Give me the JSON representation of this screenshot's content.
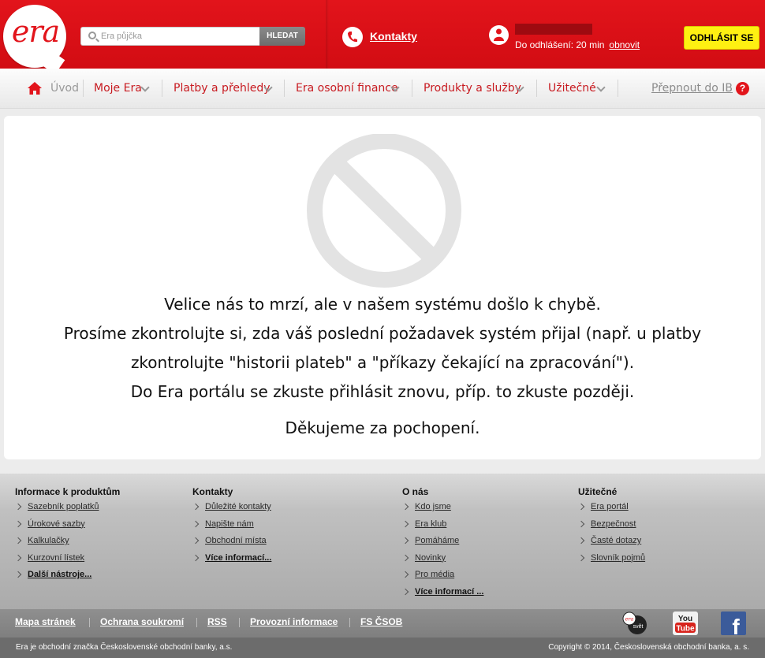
{
  "header": {
    "logo_text": "era",
    "search": {
      "placeholder": "Era půjčka",
      "button": "HLEDAT"
    },
    "contacts_label": "Kontakty",
    "user": {
      "logout_info": "Do odhlášení: 20 min",
      "renew_label": "obnovit"
    },
    "logout_button": "ODHLÁSIT SE"
  },
  "nav": {
    "home": "Úvod",
    "items": [
      "Moje Era",
      "Platby a přehledy",
      "Era osobní finance",
      "Produkty a služby",
      "Užitečné"
    ],
    "switch_label": "Přepnout do IB",
    "help": "?"
  },
  "content": {
    "lines": [
      "Velice nás to mrzí, ale v našem systému došlo k chybě.",
      "Prosíme zkontrolujte si, zda váš poslední požadavek systém přijal (např. u platby",
      "zkontrolujte \"historii plateb\" a \"příkazy čekající na zpracování\").",
      "Do Era portálu se zkuste přihlásit znovu, příp. to zkuste později."
    ],
    "thanks": "Děkujeme za pochopení."
  },
  "footer": {
    "columns": [
      {
        "title": "Informace k produktům",
        "links": [
          "Sazebník poplatků",
          "Úrokové sazby",
          "Kalkulačky",
          "Kurzovní lístek"
        ],
        "more": "Další nástroje..."
      },
      {
        "title": "Kontakty",
        "links": [
          "Důležité kontakty",
          "Napište nám",
          "Obchodní místa"
        ],
        "more": "Více informací..."
      },
      {
        "title": "O nás",
        "links": [
          "Kdo jsme",
          "Era klub",
          "Pomáháme",
          "Novinky",
          "Pro média"
        ],
        "more": "Více informací ..."
      },
      {
        "title": "Užitečné",
        "links": [
          "Era portál",
          "Bezpečnost",
          "Časté dotazy",
          "Slovník pojmů"
        ],
        "more": ""
      }
    ],
    "bottom_links": [
      "Mapa stránek",
      "Ochrana soukromí",
      "RSS",
      "Provozní informace",
      "FS ČSOB"
    ],
    "social": {
      "era_svet_top": "era",
      "era_svet_bottom": "svět",
      "youtube_top": "You",
      "youtube_bottom": "Tube",
      "facebook": "f"
    },
    "copyright_left": "Era je obchodní značka Československé obchodní banky, a.s.",
    "copyright_right": "Copyright © 2014, Československá obchodní banka, a. s."
  },
  "colors": {
    "brand_red": "#e2141b",
    "logout_yellow": "#fef012"
  }
}
